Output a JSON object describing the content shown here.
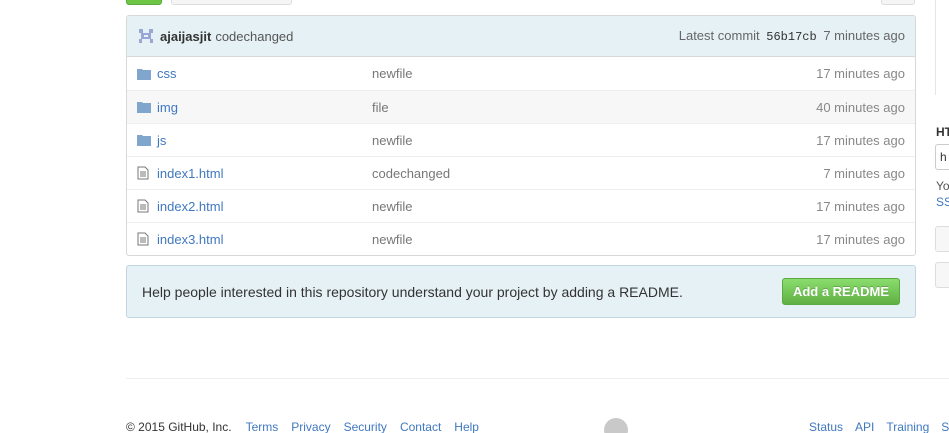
{
  "commit": {
    "author": "ajaijasjit",
    "message": "codechanged",
    "latest_label": "Latest commit",
    "sha": "56b17cb",
    "age": "7 minutes ago"
  },
  "files": [
    {
      "type": "folder",
      "name": "css",
      "message": "newfile",
      "age": "17 minutes ago"
    },
    {
      "type": "folder",
      "name": "img",
      "message": "file",
      "age": "40 minutes ago"
    },
    {
      "type": "folder",
      "name": "js",
      "message": "newfile",
      "age": "17 minutes ago"
    },
    {
      "type": "file",
      "name": "index1.html",
      "message": "codechanged",
      "age": "7 minutes ago"
    },
    {
      "type": "file",
      "name": "index2.html",
      "message": "newfile",
      "age": "17 minutes ago"
    },
    {
      "type": "file",
      "name": "index3.html",
      "message": "newfile",
      "age": "17 minutes ago"
    }
  ],
  "readme": {
    "text": "Help people interested in this repository understand your project by adding a README.",
    "button": "Add a README"
  },
  "footer": {
    "copyright": "© 2015 GitHub, Inc.",
    "links_left": [
      "Terms",
      "Privacy",
      "Security",
      "Contact",
      "Help"
    ],
    "links_right": [
      "Status",
      "API",
      "Training",
      "S"
    ]
  },
  "sidebar": {
    "title": "HT",
    "input_value": "h",
    "text": "Yo",
    "link": "SS"
  },
  "colors": {
    "link": "#4078c0",
    "accent_green": "#6cc644",
    "commit_bar": "#e6f1f6"
  }
}
